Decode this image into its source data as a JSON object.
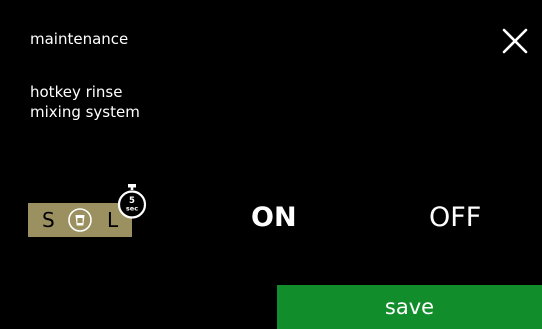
{
  "header": {
    "title": "maintenance"
  },
  "subtitle": {
    "line1": "hotkey rinse",
    "line2": "mixing system"
  },
  "hotkey": {
    "small_label": "S",
    "large_label": "L",
    "timer_value": "5",
    "timer_unit": "sec"
  },
  "toggle": {
    "on_label": "ON",
    "off_label": "OFF",
    "selected": "ON"
  },
  "footer": {
    "save_label": "save"
  },
  "colors": {
    "background": "#000000",
    "hotkey_bg": "#9b9160",
    "save_bg": "#128d2c"
  },
  "icons": {
    "close": "close-icon",
    "cup": "cup-icon",
    "timer": "stopwatch-icon"
  }
}
